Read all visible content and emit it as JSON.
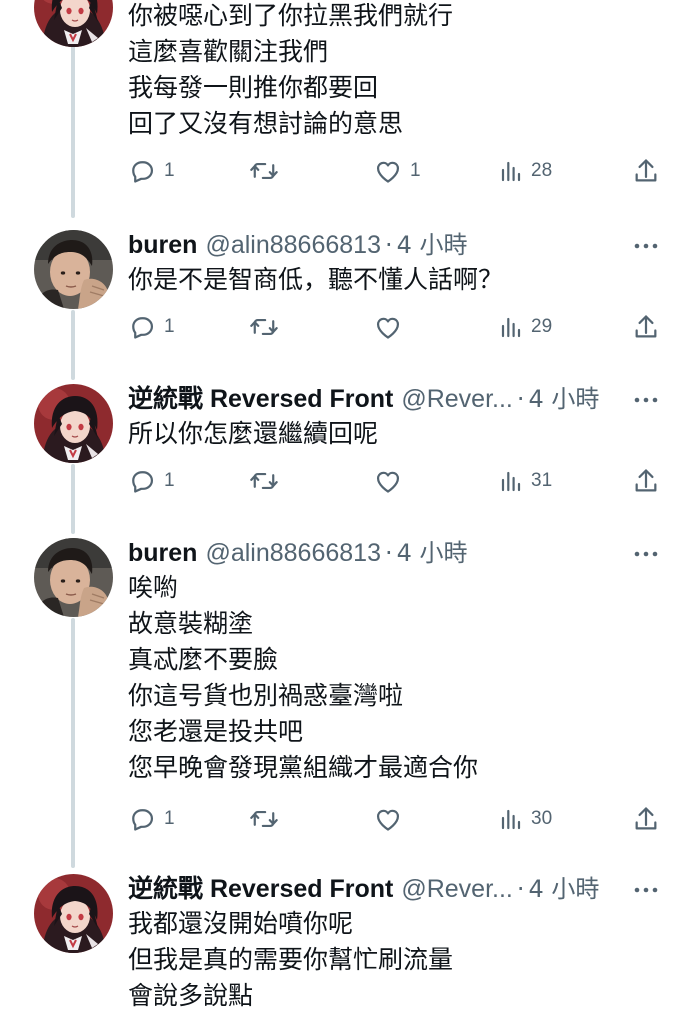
{
  "colors": {
    "text": "#0f1419",
    "secondary": "#536471",
    "thread_line": "#cfd9de"
  },
  "tweets": [
    {
      "avatar": "reversed-front-anime-avatar",
      "has_header": false,
      "lines": [
        "你被噁心到了你拉黑我們就行",
        "這麼喜歡關注我們",
        "我每發一則推你都要回",
        "回了又沒有想討論的意思"
      ],
      "stats": {
        "replies": "1",
        "retweets": "",
        "likes": "1",
        "views": "28"
      }
    },
    {
      "avatar": "buren-photo-avatar",
      "has_header": true,
      "name": "buren",
      "handle": "@alin88666813",
      "dot": "·",
      "time": "4 小時",
      "lines": [
        "你是不是智商低，聽不懂人話啊？"
      ],
      "stats": {
        "replies": "1",
        "retweets": "",
        "likes": "",
        "views": "29"
      }
    },
    {
      "avatar": "reversed-front-anime-avatar",
      "has_header": true,
      "name": "逆統戰 Reversed Front",
      "handle": "@Rever...",
      "dot": "·",
      "time": "4 小時",
      "lines": [
        "所以你怎麼還繼續回呢"
      ],
      "stats": {
        "replies": "1",
        "retweets": "",
        "likes": "",
        "views": "31"
      }
    },
    {
      "avatar": "buren-photo-avatar",
      "has_header": true,
      "name": "buren",
      "handle": "@alin88666813",
      "dot": "·",
      "time": "4 小時",
      "lines": [
        "唉喲",
        "故意裝糊塗",
        "真忒麼不要臉",
        "你這号貨也別禍惑臺灣啦",
        "您老還是投共吧",
        "您早晚會發現黨組織才最適合你"
      ],
      "stats": {
        "replies": "1",
        "retweets": "",
        "likes": "",
        "views": "30"
      }
    },
    {
      "avatar": "reversed-front-anime-avatar",
      "has_header": true,
      "name": "逆統戰 Reversed Front",
      "handle": "@Rever...",
      "dot": "·",
      "time": "4 小時",
      "lines": [
        "我都還沒開始噴你呢",
        "但我是真的需要你幫忙刷流量",
        "會說多說點"
      ],
      "stats": null
    }
  ]
}
